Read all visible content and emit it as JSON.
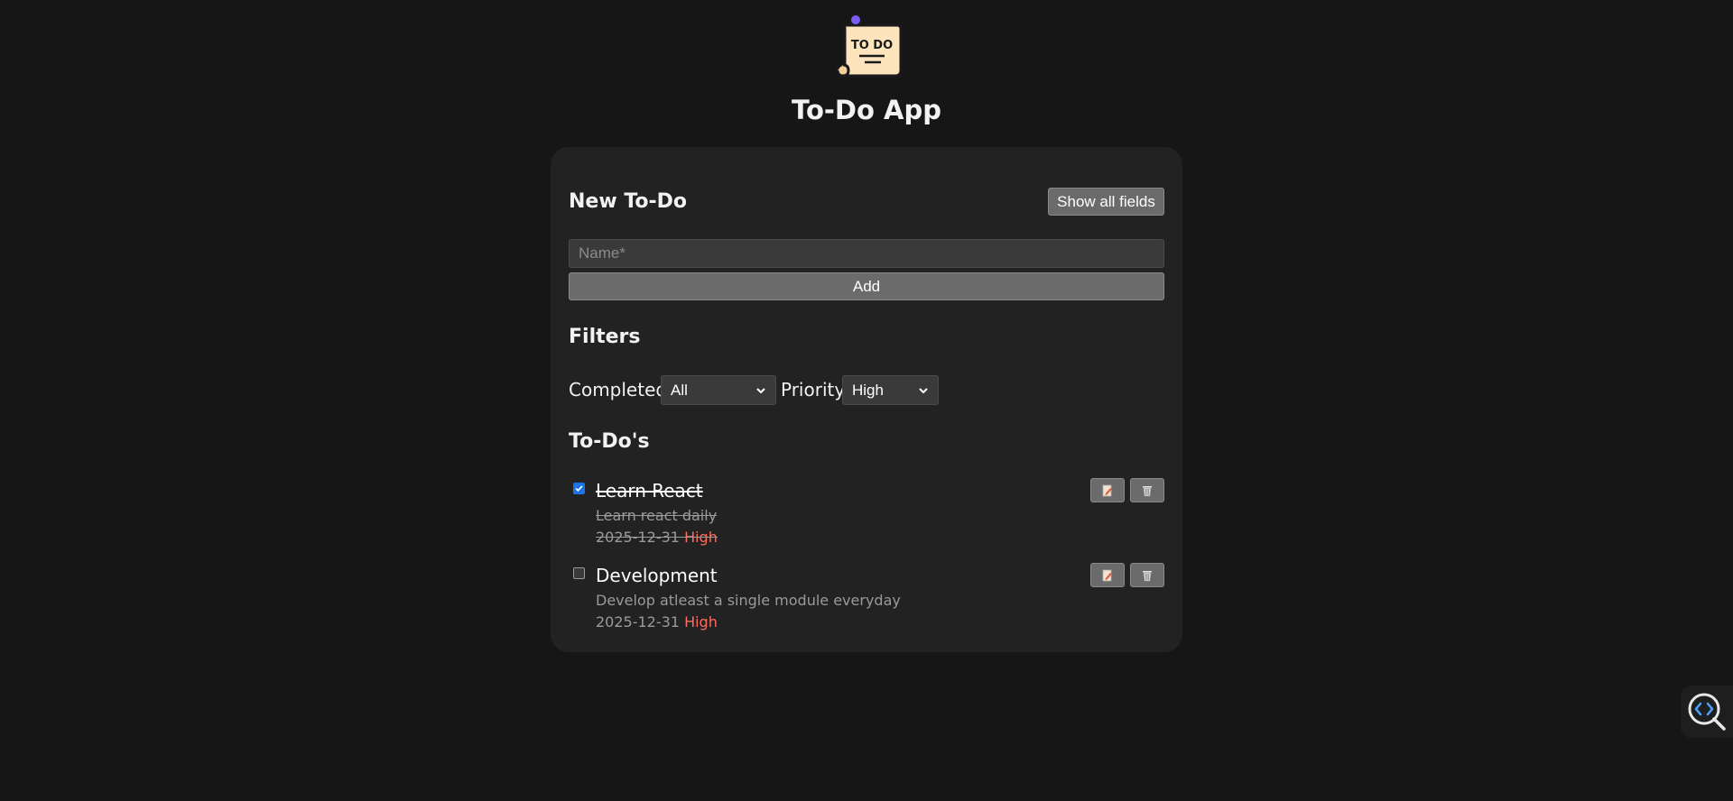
{
  "app": {
    "title": "To-Do App",
    "logo_text": "TO DO"
  },
  "new_todo": {
    "heading": "New To-Do",
    "show_all_label": "Show all fields",
    "name_placeholder": "Name*",
    "name_value": "",
    "add_label": "Add"
  },
  "filters": {
    "heading": "Filters",
    "completed_label": "Completed",
    "completed_value": "All",
    "priority_label": "Priority",
    "priority_value": "High"
  },
  "todos": {
    "heading": "To-Do's",
    "items": [
      {
        "name": "Learn React",
        "description": "Learn react daily",
        "date": "2025-12-31",
        "priority": "High",
        "completed": true
      },
      {
        "name": "Development",
        "description": "Develop atleast a single module everyday",
        "date": "2025-12-31",
        "priority": "High",
        "completed": false
      }
    ]
  },
  "colors": {
    "background": "#161616",
    "card": "#222222",
    "button": "#6b6b6b",
    "priority_high": "#ff6b5e",
    "checkbox_checked": "#1a73e8"
  },
  "icons": {
    "edit": "edit-icon",
    "delete": "trash-icon",
    "inspect": "code-inspect-icon"
  }
}
